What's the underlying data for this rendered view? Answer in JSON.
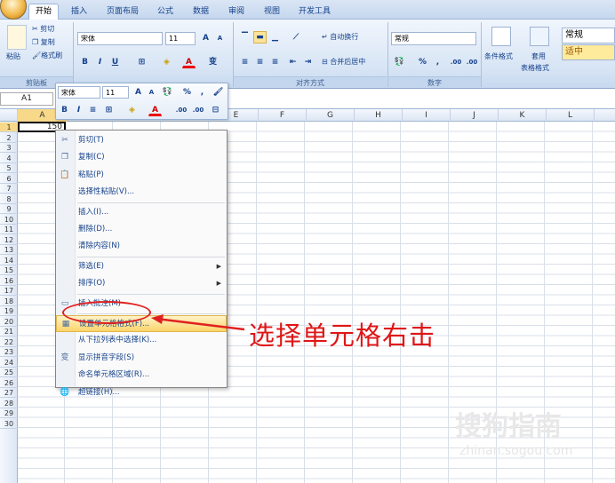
{
  "tabs": [
    {
      "label": "开始",
      "active": true
    },
    {
      "label": "插入"
    },
    {
      "label": "页面布局"
    },
    {
      "label": "公式"
    },
    {
      "label": "数据"
    },
    {
      "label": "审阅"
    },
    {
      "label": "视图"
    },
    {
      "label": "开发工具"
    }
  ],
  "clipboard": {
    "paste": "粘贴",
    "cut": "剪切",
    "copy": "复制",
    "format_painter": "格式刷",
    "group": "剪贴板"
  },
  "font": {
    "name": "宋体",
    "size": "11",
    "bold": "B",
    "italic": "I",
    "underline": "U",
    "font_color": "A",
    "grow": "A",
    "shrink": "A",
    "phonetic": "变",
    "group": "字体"
  },
  "alignment": {
    "wrap": "自动换行",
    "merge": "合并后居中",
    "group": "对齐方式"
  },
  "number": {
    "format": "常规",
    "percent": "%",
    "comma": ",",
    "inc": ".00",
    "dec": ".00",
    "group": "数字"
  },
  "styles": {
    "conditional": "条件格式",
    "table": "套用",
    "table2": "表格格式",
    "style_normal": "常规",
    "style_good": "适中"
  },
  "namebox": "A1",
  "columns": [
    "A",
    "B",
    "C",
    "D",
    "E",
    "F",
    "G",
    "H",
    "I",
    "J",
    "K",
    "L"
  ],
  "rows": [
    "1",
    "2",
    "3",
    "4",
    "5",
    "6",
    "7",
    "8",
    "9",
    "10",
    "11",
    "12",
    "13",
    "14",
    "15",
    "16",
    "17",
    "18",
    "19",
    "20",
    "21",
    "22",
    "23",
    "24",
    "25",
    "26",
    "27",
    "28",
    "29",
    "30"
  ],
  "cell_a1": "150",
  "mini": {
    "font": "宋体",
    "size": "11",
    "bold": "B",
    "italic": "I",
    "align": "≡",
    "percent": "%",
    "comma": ",",
    "inc": ".00",
    "dec": ".00"
  },
  "menu": [
    {
      "label": "剪切(T)",
      "icon": "scissors-icon",
      "glyph": "✂"
    },
    {
      "label": "复制(C)",
      "icon": "copy-icon",
      "glyph": "❐"
    },
    {
      "label": "粘贴(P)",
      "icon": "paste-icon",
      "glyph": "📋"
    },
    {
      "label": "选择性粘贴(V)...",
      "sep_after": true
    },
    {
      "label": "插入(I)..."
    },
    {
      "label": "删除(D)..."
    },
    {
      "label": "清除内容(N)",
      "sep_after": true
    },
    {
      "label": "筛选(E)",
      "arrow": true
    },
    {
      "label": "排序(O)",
      "arrow": true,
      "sep_after": true
    },
    {
      "label": "插入批注(M)",
      "icon": "comment-icon",
      "glyph": "▭",
      "sep_after": true
    },
    {
      "label": "设置单元格格式(F)...",
      "icon": "format-cells-icon",
      "glyph": "▦",
      "hover": true
    },
    {
      "label": "从下拉列表中选择(K)..."
    },
    {
      "label": "显示拼音字段(S)",
      "icon": "phonetic-icon",
      "glyph": "变"
    },
    {
      "label": "命名单元格区域(R)..."
    },
    {
      "label": "超链接(H)...",
      "icon": "hyperlink-icon",
      "glyph": "🌐"
    }
  ],
  "annotation": "选择单元格右击",
  "watermark": "搜狗指南",
  "watermark_url": "zhinan.sogou.com"
}
